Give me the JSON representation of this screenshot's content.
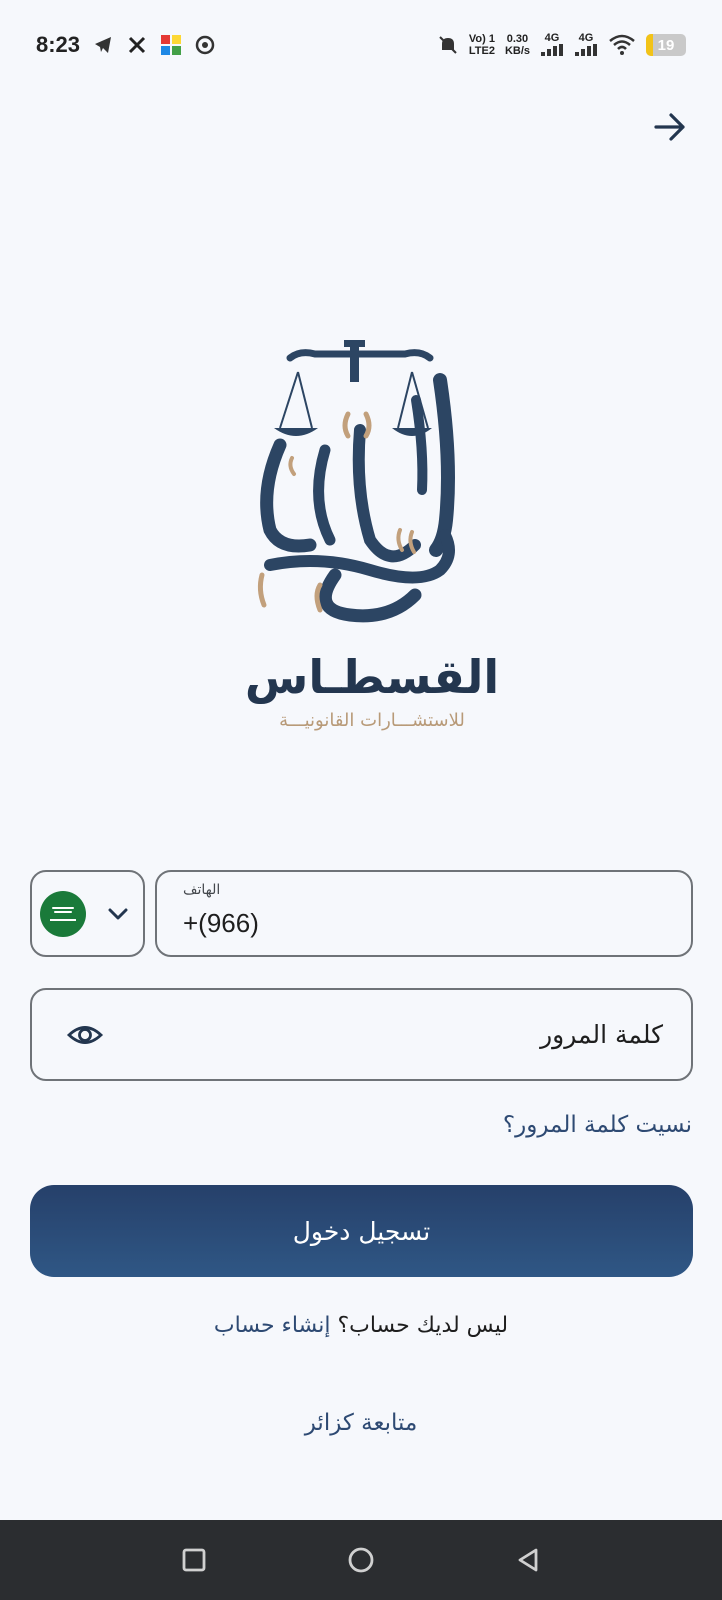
{
  "status_bar": {
    "time": "8:23",
    "network_top": "Vo) 1",
    "network_bottom": "LTE2",
    "speed_value": "0.30",
    "speed_unit": "KB/s",
    "sim1": "4G",
    "sim2": "4G",
    "battery": "19"
  },
  "logo": {
    "name": "القسطـاس",
    "subtitle": "للاستشـــارات القانونيـــة"
  },
  "form": {
    "phone_label": "الهاتف",
    "phone_value": "+(966)",
    "country_code": "SA",
    "password_placeholder": "كلمة المرور",
    "forgot_password": "نسيت كلمة المرور؟",
    "login_button": "تسجيل دخول",
    "no_account_text": "ليس لديك حساب؟",
    "create_account": "إنشاء حساب",
    "guest": "متابعة كزائر"
  },
  "colors": {
    "primary": "#26406a",
    "accent_gold": "#b89a78",
    "background": "#f6f8fc",
    "flag_green": "#1a7a3a"
  },
  "icons": {
    "back": "arrow-right-icon",
    "eye": "eye-icon",
    "chevron": "chevron-down-icon"
  }
}
